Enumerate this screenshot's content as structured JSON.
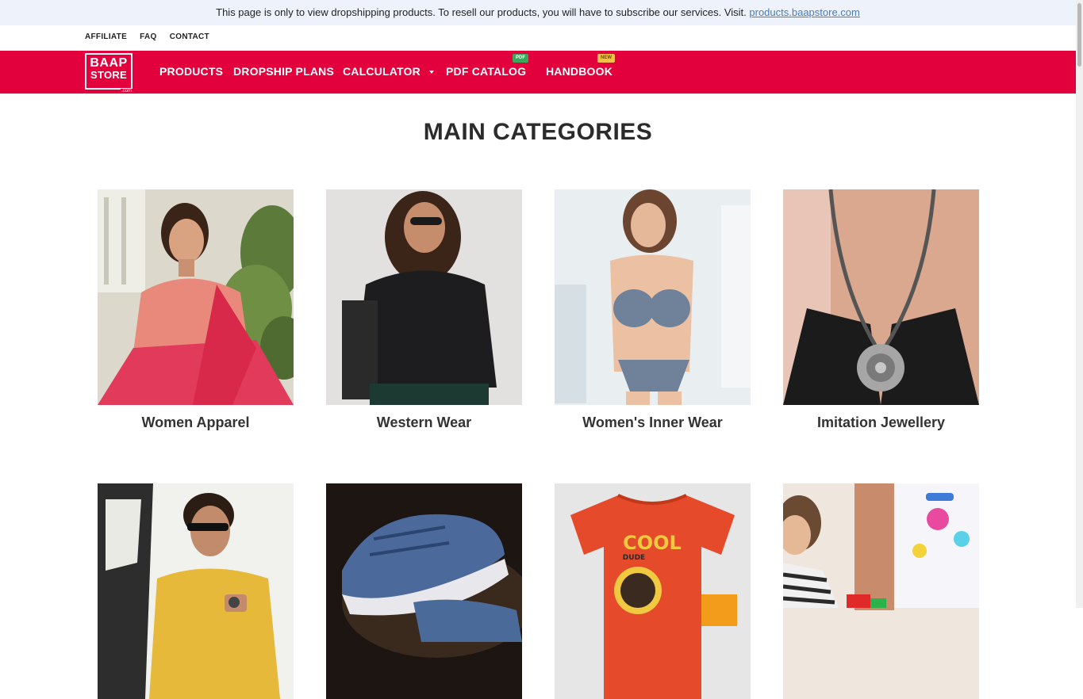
{
  "notice": {
    "text": "This page is only to view dropshipping products. To resell our products, you will have to subscribe our services. Visit.",
    "link": "products.baapstore.com"
  },
  "top_links": [
    "AFFILIATE",
    "FAQ",
    "CONTACT"
  ],
  "logo": {
    "line1": "BAAP",
    "line2": "STORE",
    "line3": ".com"
  },
  "nav": {
    "products": "PRODUCTS",
    "plans": "DROPSHIP PLANS",
    "calculator": "CALCULATOR",
    "catalog": "PDF CATALOG",
    "catalog_badge": "PDF",
    "handbook": "HANDBOOK",
    "handbook_badge": "NEW"
  },
  "colors": {
    "brand": "#e2003d",
    "notice_bg": "#eef2fb"
  },
  "page_title": "MAIN CATEGORIES",
  "categories": [
    {
      "label": "Women Apparel",
      "icon": "saree-model-image"
    },
    {
      "label": "Western Wear",
      "icon": "shirt-model-image"
    },
    {
      "label": "Women's Inner Wear",
      "icon": "innerwear-model-image"
    },
    {
      "label": "Imitation Jewellery",
      "icon": "necklace-image"
    },
    {
      "label": "",
      "icon": "men-shirt-model-image"
    },
    {
      "label": "",
      "icon": "sneakers-image"
    },
    {
      "label": "",
      "icon": "kids-tshirt-image"
    },
    {
      "label": "",
      "icon": "kids-toys-image"
    }
  ],
  "tshirt_print": {
    "line1": "COOL",
    "line2": "DUDE"
  }
}
